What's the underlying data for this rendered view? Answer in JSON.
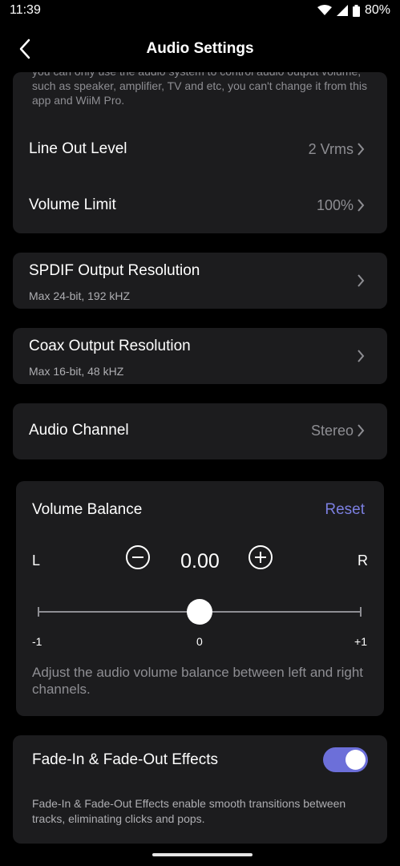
{
  "status": {
    "time": "11:39",
    "battery": "80%",
    "icons": [
      "wifi-icon",
      "signal-icon",
      "battery-icon"
    ]
  },
  "header": {
    "title": "Audio Settings",
    "back_icon": "chevron-left-icon"
  },
  "main_card": {
    "note": "you can only use the audio system to control audio output volume, such as speaker, amplifier, TV and etc, you can't change it from this app and WiiM Pro.",
    "rows": [
      {
        "label": "Line Out Level",
        "value": "2 Vrms"
      },
      {
        "label": "Volume Limit",
        "value": "100%"
      }
    ]
  },
  "spdif": {
    "label": "SPDIF Output Resolution",
    "sub": "Max 24-bit, 192 kHZ"
  },
  "coax": {
    "label": "Coax Output Resolution",
    "sub": "Max 16-bit, 48 kHZ"
  },
  "audio_channel": {
    "label": "Audio Channel",
    "value": "Stereo"
  },
  "volume_balance": {
    "title": "Volume Balance",
    "reset": "Reset",
    "left": "L",
    "right": "R",
    "value": "0.00",
    "min_label": "-1",
    "mid_label": "0",
    "max_label": "+1",
    "slider_value": 0,
    "description": "Adjust the audio volume balance between left and right channels."
  },
  "fade": {
    "title": "Fade-In & Fade-Out Effects",
    "enabled": true,
    "description": "Fade-In & Fade-Out Effects enable smooth transitions between tracks, eliminating clicks and pops."
  },
  "colors": {
    "background": "#000000",
    "card": "#1c1c1e",
    "accent": "#7b7fe0",
    "secondary_text": "#8e8e93"
  }
}
